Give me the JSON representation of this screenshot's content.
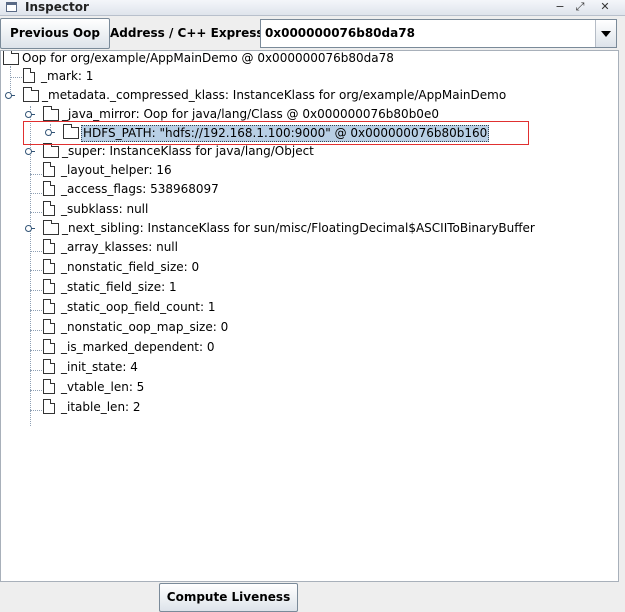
{
  "window": {
    "title": "Inspector",
    "controls": [
      "−",
      "⤢",
      "✕"
    ]
  },
  "toolbar": {
    "previous_oop_label": "Previous Oop",
    "address_label": "Address / C++ Expression:",
    "address_value": "0x000000076b80da78"
  },
  "tree": {
    "root": "Oop for org/example/AppMainDemo @ 0x000000076b80da78",
    "mark": "_mark: 1",
    "metadata": "_metadata._compressed_klass: InstanceKlass for org/example/AppMainDemo",
    "java_mirror": "_java_mirror: Oop for java/lang/Class @ 0x000000076b80b0e0",
    "hdfs_path": "HDFS_PATH: \"hdfs://192.168.1.100:9000\" @ 0x000000076b80b160",
    "super": "_super: InstanceKlass for java/lang/Object",
    "layout_helper": "_layout_helper: 16",
    "access_flags": "_access_flags: 538968097",
    "subklass": "_subklass: null",
    "next_sibling": "_next_sibling: InstanceKlass for sun/misc/FloatingDecimal$ASCIIToBinaryBuffer",
    "array_klasses": "_array_klasses: null",
    "nonstatic_field_size": "_nonstatic_field_size: 0",
    "static_field_size": "_static_field_size: 1",
    "static_oop_field_count": "_static_oop_field_count: 1",
    "nonstatic_oop_map_size": "_nonstatic_oop_map_size: 0",
    "is_marked_dependent": "_is_marked_dependent: 0",
    "init_state": "_init_state: 4",
    "vtable_len": "_vtable_len: 5",
    "itable_len": "_itable_len: 2"
  },
  "footer": {
    "compute_liveness_label": "Compute Liveness"
  }
}
